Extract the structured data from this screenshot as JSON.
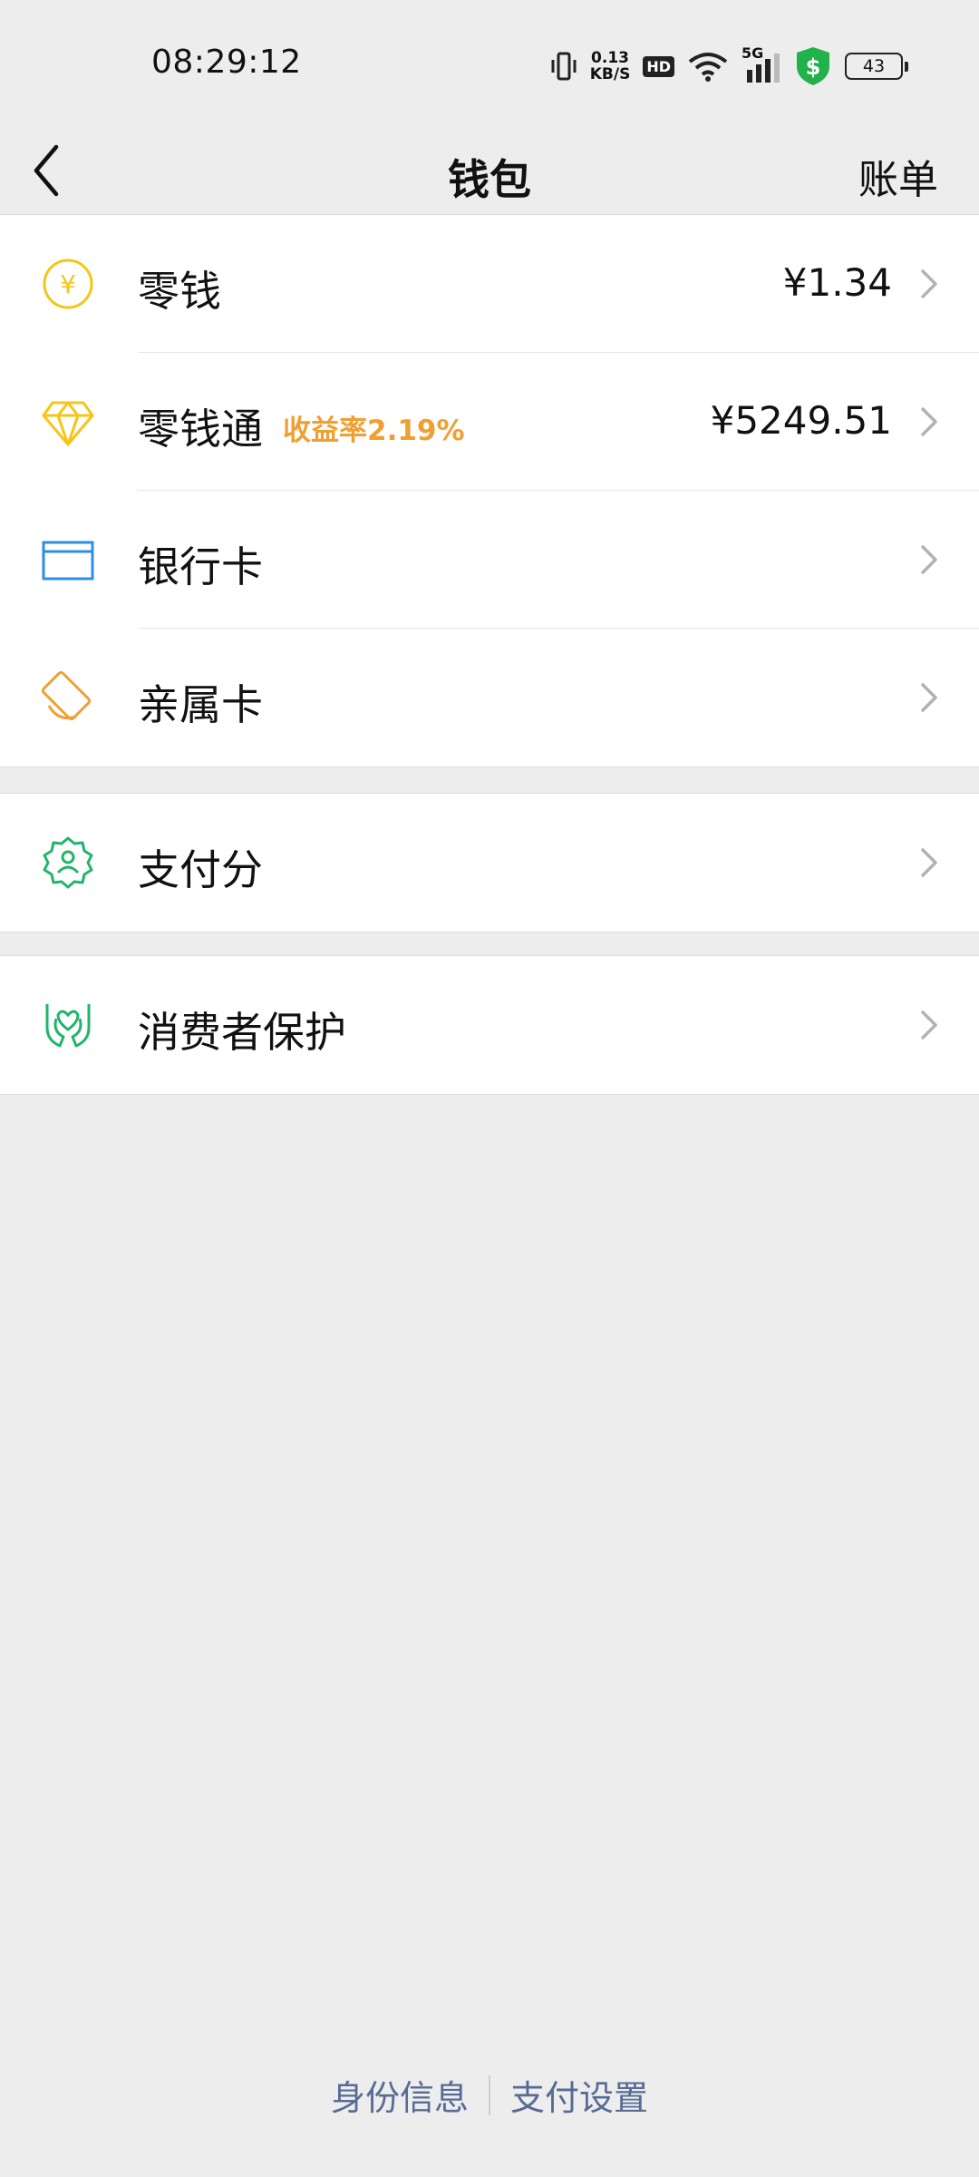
{
  "status_bar": {
    "time": "08:29:12",
    "net_speed_value": "0.13",
    "net_speed_unit": "KB/S",
    "hd": "HD",
    "signal": "5G",
    "battery": "43"
  },
  "nav": {
    "title": "钱包",
    "right_action": "账单"
  },
  "groups": [
    {
      "items": [
        {
          "label": "零钱",
          "amount": "¥1.34",
          "icon": "yuan-coin-icon"
        },
        {
          "label": "零钱通",
          "badge": "收益率2.19%",
          "amount": "¥5249.51",
          "icon": "diamond-icon"
        },
        {
          "label": "银行卡",
          "icon": "bank-card-icon"
        },
        {
          "label": "亲属卡",
          "icon": "family-card-icon"
        }
      ]
    },
    {
      "items": [
        {
          "label": "支付分",
          "icon": "pay-score-icon"
        }
      ]
    },
    {
      "items": [
        {
          "label": "消费者保护",
          "icon": "consumer-protection-icon"
        }
      ]
    }
  ],
  "footer": {
    "identity": "身份信息",
    "settings": "支付设置"
  },
  "colors": {
    "background": "#ededed",
    "accent_yellow": "#f5c518",
    "accent_orange": "#f0a032",
    "accent_blue": "#2d8fe0",
    "accent_green": "#21b56a",
    "link_blue": "#576b95"
  }
}
